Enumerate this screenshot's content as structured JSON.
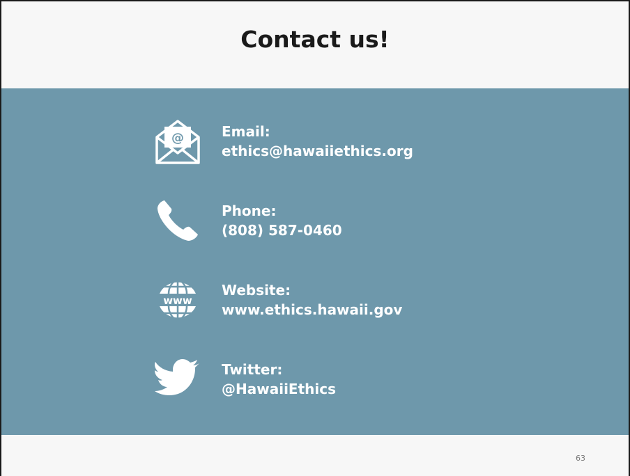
{
  "slide": {
    "title": "Contact us!",
    "page_number": "63"
  },
  "colors": {
    "band": "#6e98ab",
    "text_light": "#ffffff",
    "title": "#1a1a1a"
  },
  "contacts": [
    {
      "icon": "envelope-icon",
      "label": "Email:",
      "value": "ethics@hawaiiethics.org"
    },
    {
      "icon": "phone-icon",
      "label": "Phone:",
      "value": "(808) 587-0460"
    },
    {
      "icon": "www-globe-icon",
      "label": "Website:",
      "value": "www.ethics.hawaii.gov"
    },
    {
      "icon": "twitter-bird-icon",
      "label": "Twitter:",
      "value": "@HawaiiEthics"
    }
  ],
  "icon_text": {
    "envelope_symbol": "@",
    "globe_text": "www"
  }
}
